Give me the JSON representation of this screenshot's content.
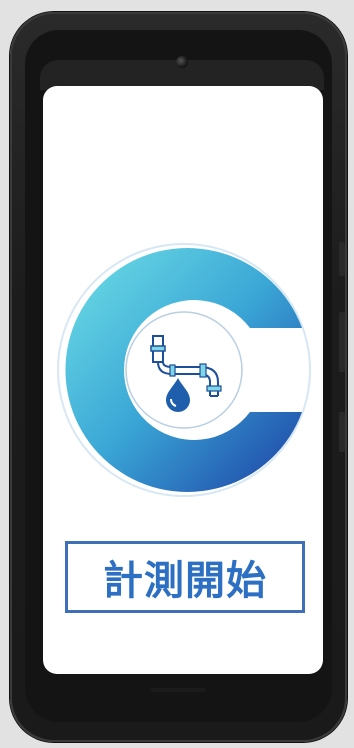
{
  "app": {
    "start_button_label": "計測開始",
    "logo_icon": "water-faucet-drop-icon"
  },
  "colors": {
    "ring_gradient_start": "#5fd7e2",
    "ring_gradient_end": "#1e48a8",
    "button_border": "#3f6fb6",
    "button_text": "#2d6fc2",
    "drop": "#1e5fae"
  }
}
